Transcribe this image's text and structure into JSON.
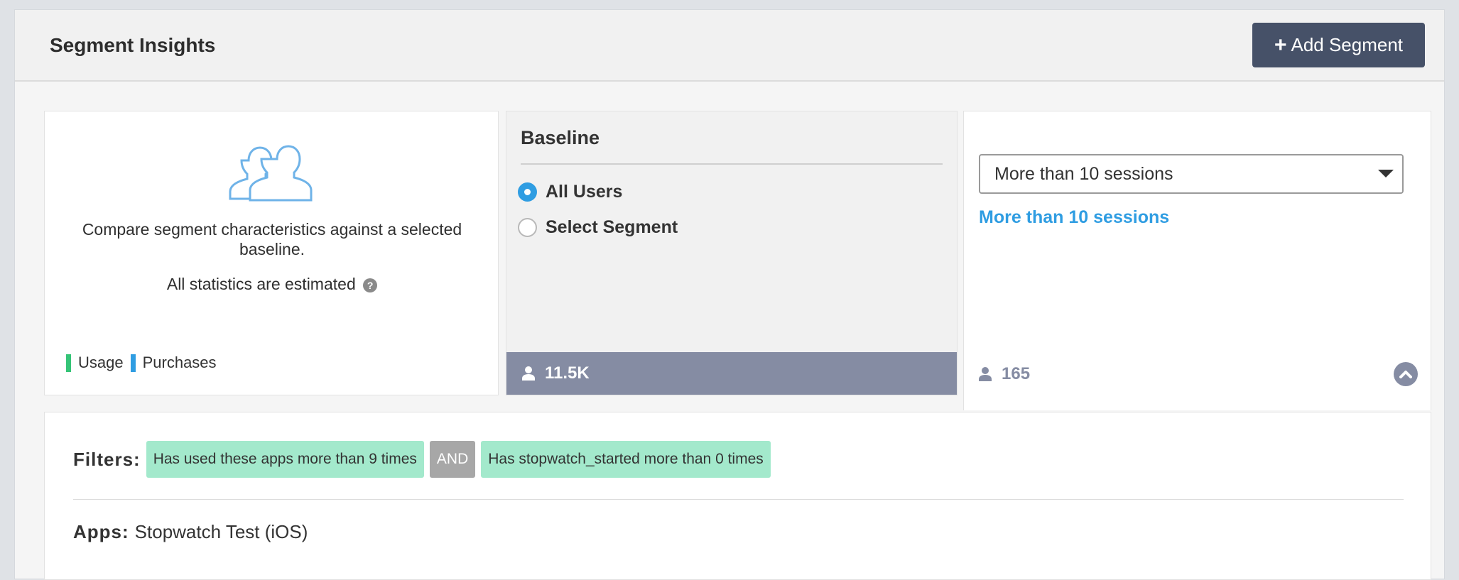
{
  "header": {
    "title": "Segment Insights",
    "add_button_label": "Add Segment"
  },
  "intro": {
    "description": "Compare segment characteristics against a selected baseline.",
    "estimate_note": "All statistics are estimated",
    "legend": [
      {
        "label": "Usage",
        "color": "#35c477"
      },
      {
        "label": "Purchases",
        "color": "#2f9de2"
      }
    ]
  },
  "baseline": {
    "title": "Baseline",
    "options": [
      {
        "label": "All Users",
        "selected": true
      },
      {
        "label": "Select Segment",
        "selected": false
      }
    ],
    "user_count": "11.5K"
  },
  "segment": {
    "selected_value": "More than 10 sessions",
    "link_label": "More than 10 sessions",
    "user_count": "165"
  },
  "filters": {
    "label": "Filters:",
    "chips": [
      {
        "text": "Has used these apps more than 9 times",
        "kind": "condition"
      },
      {
        "text": "AND",
        "kind": "operator"
      },
      {
        "text": "Has stopwatch_started more than 0 times",
        "kind": "condition"
      }
    ],
    "apps_label": "Apps:",
    "apps_value": "Stopwatch Test (iOS)"
  },
  "colors": {
    "accent": "#2f9de2",
    "button_bg": "#465168",
    "count_bar": "#858ca3",
    "filter_chip": "#a3e9cc",
    "operator_chip": "#a7a7a7"
  }
}
